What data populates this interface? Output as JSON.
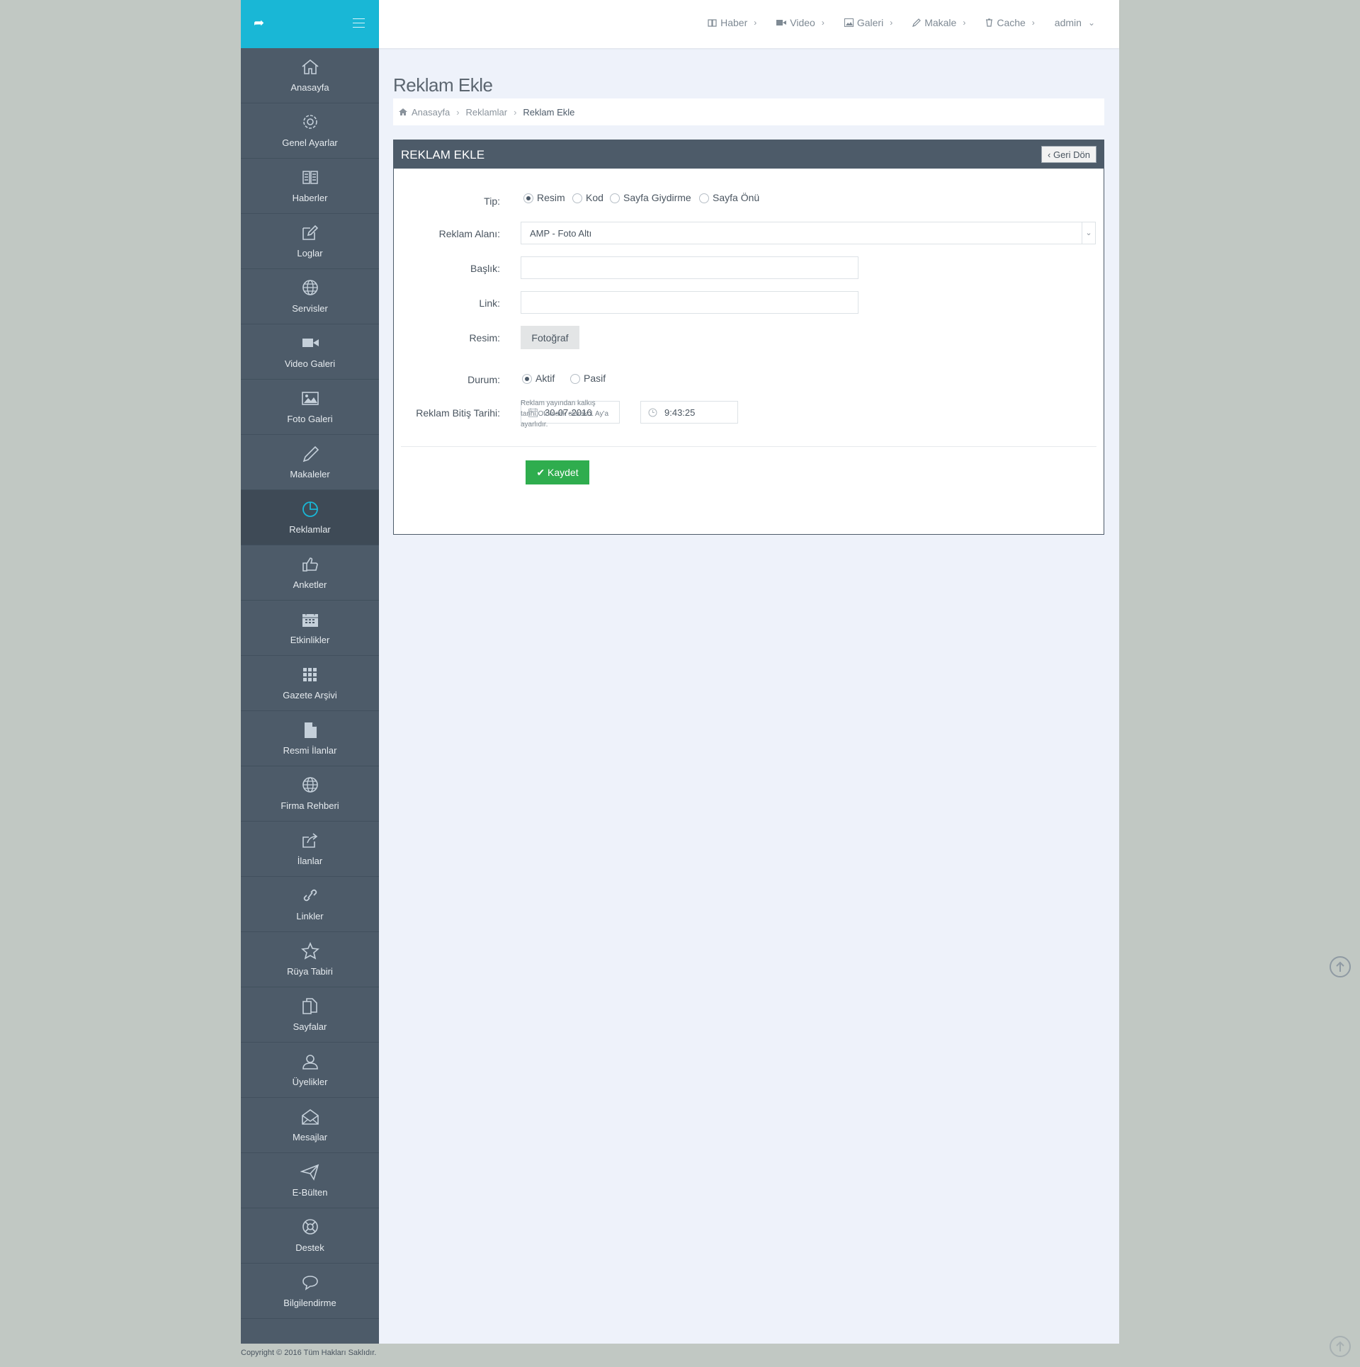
{
  "sidebar": {
    "items": [
      {
        "label": "Anasayfa",
        "icon": "home-icon"
      },
      {
        "label": "Genel Ayarlar",
        "icon": "gear-icon"
      },
      {
        "label": "Haberler",
        "icon": "book-icon"
      },
      {
        "label": "Loglar",
        "icon": "edit-icon"
      },
      {
        "label": "Servisler",
        "icon": "globe-icon"
      },
      {
        "label": "Video Galeri",
        "icon": "video-camera-icon"
      },
      {
        "label": "Foto Galeri",
        "icon": "image-icon"
      },
      {
        "label": "Makaleler",
        "icon": "pencil-icon"
      },
      {
        "label": "Reklamlar",
        "icon": "pie-chart-icon"
      },
      {
        "label": "Anketler",
        "icon": "thumbs-up-icon"
      },
      {
        "label": "Etkinlikler",
        "icon": "calendar-icon"
      },
      {
        "label": "Gazete Arşivi",
        "icon": "grid-icon"
      },
      {
        "label": "Resmi İlanlar",
        "icon": "document-icon"
      },
      {
        "label": "Firma Rehberi",
        "icon": "globe-icon"
      },
      {
        "label": "İlanlar",
        "icon": "share-square-icon"
      },
      {
        "label": "Linkler",
        "icon": "link-icon"
      },
      {
        "label": "Rüya Tabiri",
        "icon": "star-icon"
      },
      {
        "label": "Sayfalar",
        "icon": "copy-icon"
      },
      {
        "label": "Üyelikler",
        "icon": "user-icon"
      },
      {
        "label": "Mesajlar",
        "icon": "envelope-open-icon"
      },
      {
        "label": "E-Bülten",
        "icon": "paper-plane-icon"
      },
      {
        "label": "Destek",
        "icon": "life-ring-icon"
      },
      {
        "label": "Bilgilendirme",
        "icon": "speech-bubble-icon"
      }
    ],
    "active_index": 8
  },
  "topnav": {
    "haber": "Haber",
    "video": "Video",
    "galeri": "Galeri",
    "makale": "Makale",
    "cache": "Cache",
    "user": "admin"
  },
  "page": {
    "title": "Reklam Ekle"
  },
  "breadcrumb": {
    "home": "Anasayfa",
    "section": "Reklamlar",
    "current": "Reklam Ekle"
  },
  "panel": {
    "title": "REKLAM EKLE",
    "back_label": "Geri Dön"
  },
  "form": {
    "tip_label": "Tip:",
    "tip_options": [
      "Resim",
      "Kod",
      "Sayfa Giydirme",
      "Sayfa Önü"
    ],
    "tip_selected": "Resim",
    "alan_label": "Reklam Alanı:",
    "alan_value": "AMP - Foto Altı",
    "baslik_label": "Başlık:",
    "baslik_value": "",
    "link_label": "Link:",
    "link_value": "",
    "resim_label": "Resim:",
    "resim_button": "Fotoğraf",
    "durum_label": "Durum:",
    "durum_options": [
      "Aktif",
      "Pasif"
    ],
    "durum_selected": "Aktif",
    "bitis_label": "Reklam Bitiş Tarihi:",
    "bitis_date": "30-07-2016",
    "bitis_time": "9:43:25",
    "bitis_hint": "Reklam yayından kalkış tarihi.Otomaitk olarak 1 Ay'a ayarlıdır.",
    "save_label": "Kaydet"
  },
  "footer": {
    "copyright": "Copyright © 2016 Tüm Hakları Saklıdır."
  },
  "colors": {
    "brand": "#19b7d6",
    "sidebar": "#4d5b69",
    "save": "#2fad4e",
    "background": "#eef2fa"
  }
}
